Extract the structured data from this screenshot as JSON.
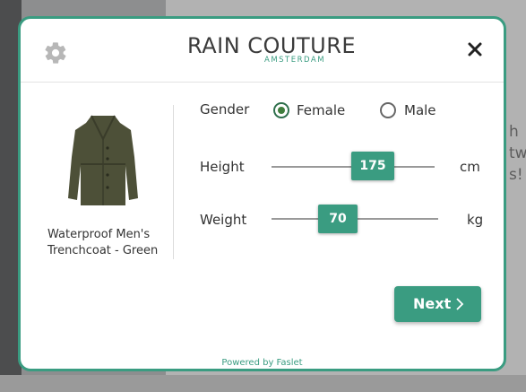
{
  "background": {
    "text_fragments": [
      "h",
      "tw",
      "s!"
    ]
  },
  "modal": {
    "logo": {
      "main": "RAIN COUTURE",
      "sub": "AMSTERDAM"
    },
    "product": {
      "name": "Waterproof Men's Trenchcoat - Green"
    },
    "gender": {
      "label": "Gender",
      "options": [
        "Female",
        "Male"
      ],
      "selected": "Female"
    },
    "height": {
      "label": "Height",
      "value": "175",
      "unit": "cm"
    },
    "weight": {
      "label": "Weight",
      "value": "70",
      "unit": "kg"
    },
    "next_label": "Next",
    "powered_by": "Powered by Faslet"
  },
  "colors": {
    "accent": "#3a9c81",
    "radio_selected": "#3f7d3d"
  },
  "icons": {
    "settings": "gear-icon",
    "close": "close-icon",
    "next": "chevron-right-icon"
  }
}
